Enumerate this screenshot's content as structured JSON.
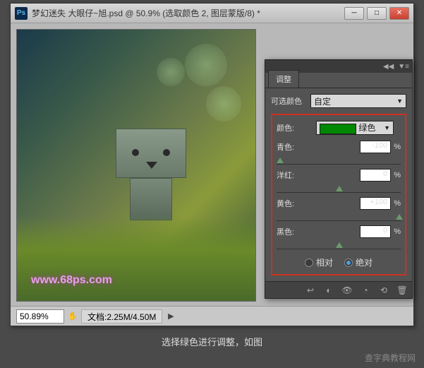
{
  "titlebar": {
    "ps": "Ps",
    "title": "梦幻迷失 大眼仔~旭.psd @ 50.9% (选取颜色 2, 图层蒙版/8) *"
  },
  "canvas": {
    "watermark": "www.68ps.com"
  },
  "statusbar": {
    "zoom": "50.89%",
    "doc_info": "文档:2.25M/4.50M"
  },
  "panel": {
    "tab": "调整",
    "preset_label": "可选颜色",
    "preset_value": "自定",
    "color_label": "颜色:",
    "color_value": "绿色",
    "sliders": [
      {
        "label": "青色:",
        "value": "-100",
        "pos": 0
      },
      {
        "label": "洋红:",
        "value": "0",
        "pos": 50
      },
      {
        "label": "黄色:",
        "value": "+100",
        "pos": 100
      },
      {
        "label": "黑色:",
        "value": "0",
        "pos": 50
      }
    ],
    "radios": {
      "relative": "相对",
      "absolute": "绝对"
    }
  },
  "caption": "选择绿色进行调整，如图",
  "site": "查字典教程网"
}
